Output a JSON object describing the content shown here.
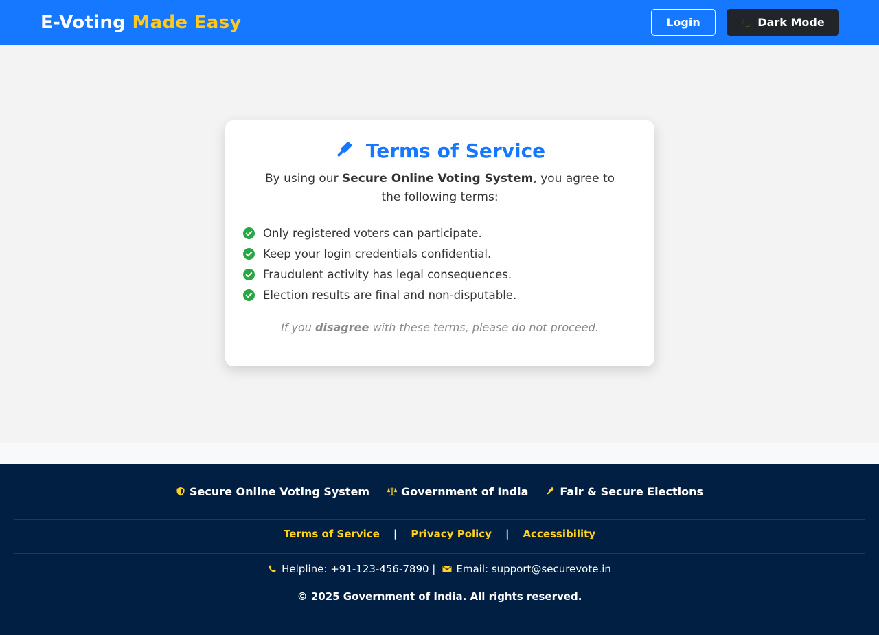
{
  "header": {
    "brand_main": "E-Voting",
    "brand_accent": "Made Easy",
    "login_label": "Login",
    "dark_mode_label": "Dark Mode"
  },
  "card": {
    "title": "Terms of Service",
    "intro_prefix": "By using our",
    "intro_bold": "Secure Online Voting System",
    "intro_suffix": ", you agree to the following terms:",
    "terms": [
      "Only registered voters can participate.",
      "Keep your login credentials confidential.",
      "Fraudulent activity has legal consequences.",
      "Election results are final and non-disputable."
    ],
    "note_prefix": "If you",
    "note_bold": "disagree",
    "note_suffix": "with these terms, please do not proceed."
  },
  "footer": {
    "badges": [
      {
        "label": "Secure Online Voting System",
        "icon": "shield-icon"
      },
      {
        "label": "Government of India",
        "icon": "scales-icon"
      },
      {
        "label": "Fair & Secure Elections",
        "icon": "gavel-icon"
      }
    ],
    "links": [
      "Terms of Service",
      "Privacy Policy",
      "Accessibility"
    ],
    "separator": "|",
    "helpline": "Helpline: +91-123-456-7890 |",
    "email": "Email: support@securevote.in",
    "copyright": "© 2025 Government of India. All rights reserved."
  },
  "colors": {
    "primary": "#1677ff",
    "accent": "#ffc91f",
    "footer_bg": "#001f42",
    "check": "#28a745"
  }
}
